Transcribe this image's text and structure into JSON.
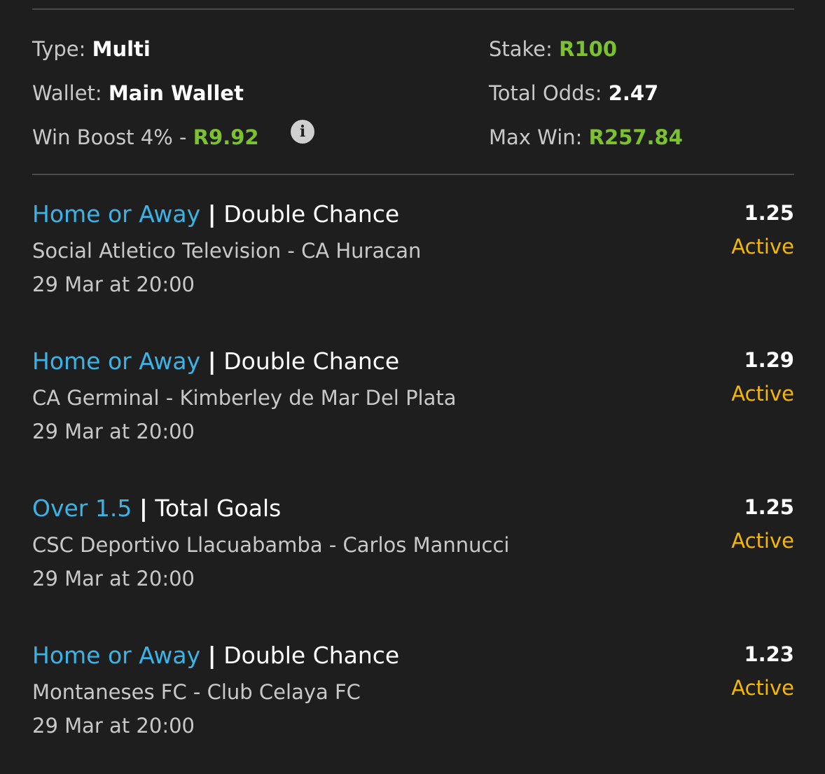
{
  "summary": {
    "type_label": "Type:",
    "type_value": "Multi",
    "wallet_label": "Wallet:",
    "wallet_value": "Main Wallet",
    "boost_label": "Win Boost 4% -",
    "boost_value": "R9.92",
    "info_icon": "i",
    "stake_label": "Stake:",
    "stake_value": "R100",
    "odds_label": "Total Odds:",
    "odds_value": "2.47",
    "maxwin_label": "Max Win:",
    "maxwin_value": "R257.84"
  },
  "selections": [
    {
      "pick": "Home or Away",
      "separator": "|",
      "market": "Double Chance",
      "match": "Social Atletico Television - CA Huracan",
      "time": "29 Mar at 20:00",
      "odds": "1.25",
      "status": "Active"
    },
    {
      "pick": "Home or Away",
      "separator": "|",
      "market": "Double Chance",
      "match": "CA Germinal - Kimberley de Mar Del Plata",
      "time": "29 Mar at 20:00",
      "odds": "1.29",
      "status": "Active"
    },
    {
      "pick": "Over 1.5",
      "separator": "|",
      "market": "Total Goals",
      "match": "CSC Deportivo Llacuabamba - Carlos Mannucci",
      "time": "29 Mar at 20:00",
      "odds": "1.25",
      "status": "Active"
    },
    {
      "pick": "Home or Away",
      "separator": "|",
      "market": "Double Chance",
      "match": "Montaneses FC - Club Celaya FC",
      "time": "29 Mar at 20:00",
      "odds": "1.23",
      "status": "Active"
    }
  ],
  "colors": {
    "background": "#1e1e1e",
    "pick_blue": "#3bb3e6",
    "money_green": "#7cc22e",
    "status_yellow": "#f5b800"
  }
}
